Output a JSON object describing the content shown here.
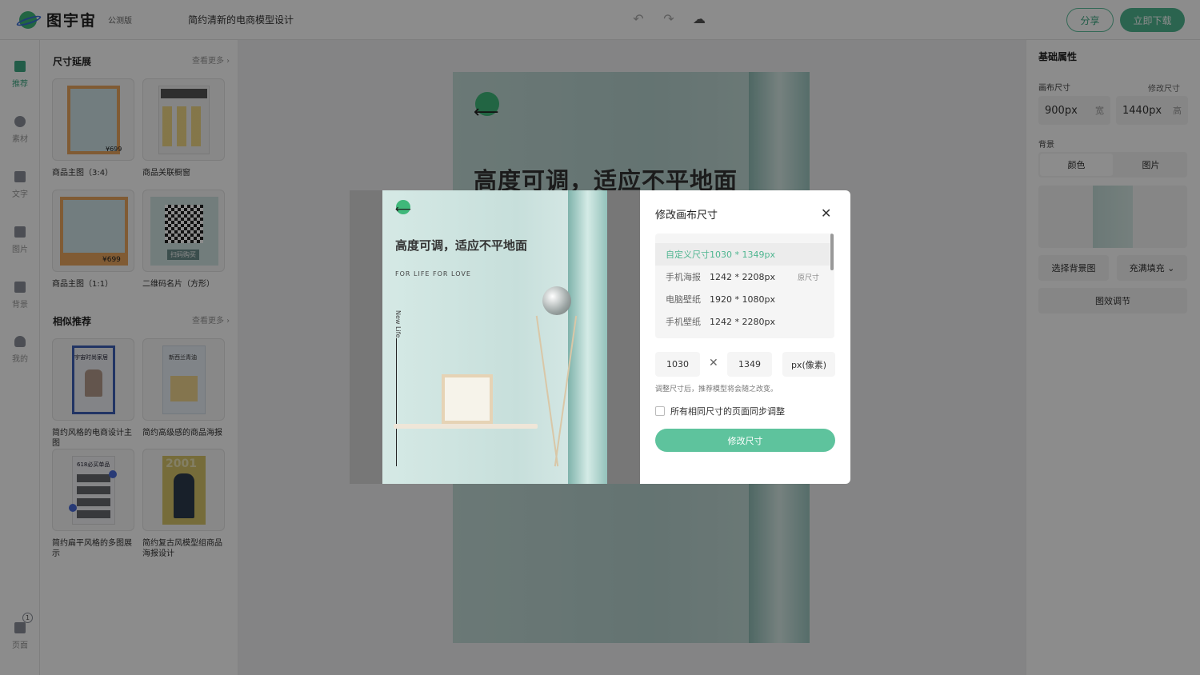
{
  "app": {
    "logo_text": "图宇宙",
    "beta": "公测版",
    "doc_title": "简约清新的电商模型设计"
  },
  "toolbar": {
    "undo": "↶",
    "redo": "↷",
    "cloud": "☁"
  },
  "header": {
    "share": "分享",
    "download": "立即下载"
  },
  "rail": [
    {
      "label": "推荐",
      "icon": "recommend-icon"
    },
    {
      "label": "素材",
      "icon": "shapes-icon"
    },
    {
      "label": "文字",
      "icon": "text-icon"
    },
    {
      "label": "图片",
      "icon": "image-icon"
    },
    {
      "label": "背景",
      "icon": "background-icon"
    },
    {
      "label": "我的",
      "icon": "user-icon"
    },
    {
      "label": "页面",
      "icon": "pages-icon",
      "badge": "1"
    }
  ],
  "panel": {
    "section1": {
      "title": "尺寸延展",
      "more": "查看更多 ›"
    },
    "section2": {
      "title": "相似推荐",
      "more": "查看更多 ›"
    },
    "templates1": [
      {
        "caption": "商品主图（3:4）",
        "price": "¥699"
      },
      {
        "caption": "商品关联橱窗"
      },
      {
        "caption": "商品主图（1:1）",
        "price": "¥699"
      },
      {
        "caption": "二维码名片（方形）",
        "badge": "扫码购买"
      }
    ],
    "templates2": [
      {
        "caption": "简约风格的电商设计主图",
        "badge": "宇宙时尚家居"
      },
      {
        "caption": "简约高级感的商品海报",
        "badge": "新西兰青油"
      },
      {
        "caption": "简约扁平风格的多图展示",
        "badge": "618必买单品"
      },
      {
        "caption": "简约复古风模型组商品海报设计",
        "badge": "2001"
      }
    ]
  },
  "poster": {
    "headline": "高度可调，适应不平地面",
    "arrow": "⟵"
  },
  "props": {
    "title": "基础属性",
    "canvas_size_label": "画布尺寸",
    "modify_size": "修改尺寸",
    "width_value": "900px",
    "width_unit": "宽",
    "height_value": "1440px",
    "height_unit": "高",
    "background_label": "背景",
    "tab_color": "颜色",
    "tab_image": "图片",
    "choose_bg": "选择背景图",
    "fill_mode": "充满填充 ⌄",
    "effect": "图效调节"
  },
  "modal": {
    "title": "修改画布尺寸",
    "close": "✕",
    "preview": {
      "title": "高度可调，适应不平地面",
      "sub": "FOR LIFE  FOR LOVE",
      "vertical": "New Life"
    },
    "sizes": [
      {
        "name": "自定义尺寸",
        "dims": "1030 * 1349px",
        "tag": "",
        "selected": true
      },
      {
        "name": "手机海报",
        "dims": "1242 * 2208px",
        "tag": "原尺寸"
      },
      {
        "name": "电脑壁纸",
        "dims": "1920 * 1080px",
        "tag": ""
      },
      {
        "name": "手机壁纸",
        "dims": "1242 * 2280px",
        "tag": ""
      }
    ],
    "width_input": "1030",
    "height_input": "1349",
    "times": "✕",
    "unit": "px(像素)",
    "hint": "调整尺寸后，推荐模型将会随之改变。",
    "sync_label": "所有相同尺寸的页面同步调整",
    "submit": "修改尺寸"
  },
  "colors": {
    "accent": "#4fb690",
    "overlay": "rgba(0,0,0,0.45)"
  }
}
